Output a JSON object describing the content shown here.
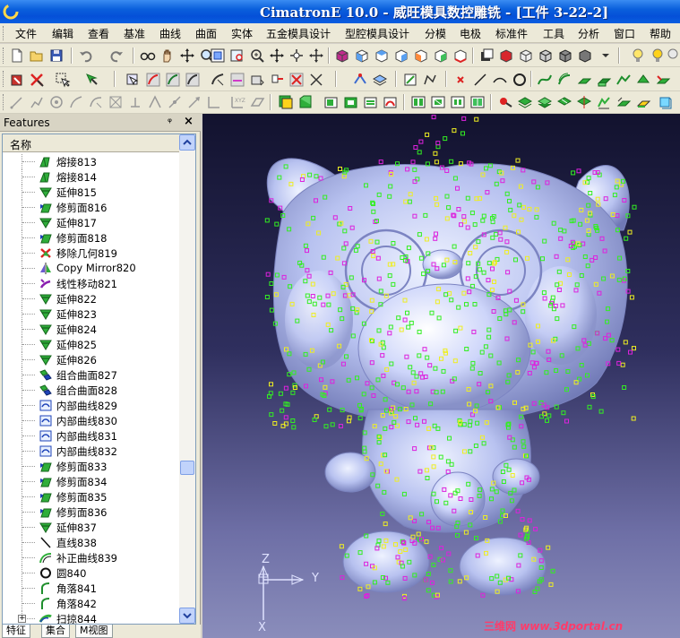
{
  "window": {
    "title": "CimatronE 10.0 - 威旺模具数控雕铣 - [工件 3-22-2]"
  },
  "menu": {
    "items": [
      "文件",
      "编辑",
      "查看",
      "基准",
      "曲线",
      "曲面",
      "实体",
      "五金模具设计",
      "型腔模具设计",
      "分模",
      "电极",
      "标准件",
      "工具",
      "分析",
      "窗口",
      "帮助"
    ]
  },
  "features_panel": {
    "title": "Features",
    "pin": "ᵠ",
    "close": "×",
    "column_header": "名称",
    "items": [
      {
        "label": "熔接813",
        "icon": "weld-icon"
      },
      {
        "label": "熔接814",
        "icon": "weld-icon"
      },
      {
        "label": "延伸815",
        "icon": "extend-icon"
      },
      {
        "label": "修剪面816",
        "icon": "trim-face-icon"
      },
      {
        "label": "延伸817",
        "icon": "extend-icon"
      },
      {
        "label": "修剪面818",
        "icon": "trim-face-icon"
      },
      {
        "label": "移除几何819",
        "icon": "remove-geometry-icon"
      },
      {
        "label": "Copy Mirror820",
        "icon": "mirror-icon"
      },
      {
        "label": "线性移动821",
        "icon": "linear-move-icon"
      },
      {
        "label": "延伸822",
        "icon": "extend-icon"
      },
      {
        "label": "延伸823",
        "icon": "extend-icon"
      },
      {
        "label": "延伸824",
        "icon": "extend-icon"
      },
      {
        "label": "延伸825",
        "icon": "extend-icon"
      },
      {
        "label": "延伸826",
        "icon": "extend-icon"
      },
      {
        "label": "组合曲面827",
        "icon": "combine-surface-icon"
      },
      {
        "label": "组合曲面828",
        "icon": "combine-surface-icon"
      },
      {
        "label": "内部曲线829",
        "icon": "internal-curve-icon"
      },
      {
        "label": "内部曲线830",
        "icon": "internal-curve-icon"
      },
      {
        "label": "内部曲线831",
        "icon": "internal-curve-icon"
      },
      {
        "label": "内部曲线832",
        "icon": "internal-curve-icon"
      },
      {
        "label": "修剪面833",
        "icon": "trim-face-icon"
      },
      {
        "label": "修剪面834",
        "icon": "trim-face-icon"
      },
      {
        "label": "修剪面835",
        "icon": "trim-face-icon"
      },
      {
        "label": "修剪面836",
        "icon": "trim-face-icon"
      },
      {
        "label": "延伸837",
        "icon": "extend-icon"
      },
      {
        "label": "直线838",
        "icon": "line-icon"
      },
      {
        "label": "补正曲线839",
        "icon": "offset-curve-icon"
      },
      {
        "label": "圆840",
        "icon": "circle-icon"
      },
      {
        "label": "角落841",
        "icon": "corner-icon"
      },
      {
        "label": "角落842",
        "icon": "corner-icon"
      },
      {
        "label": "扫掠844",
        "icon": "sweep-icon"
      }
    ],
    "tabs": [
      "特征",
      "集合",
      "M视图"
    ]
  },
  "viewport": {
    "axis_z": "Z",
    "axis_y": "Y",
    "axis_x": "X",
    "watermark_cn": "三维网",
    "watermark_en": "www.3dportal.cn",
    "colors": {
      "background_top": "#12122e",
      "background_bottom": "#8a8dbb",
      "model": "#b8c2f0",
      "point_green": "#33ee22",
      "point_magenta": "#dd22dd",
      "point_yellow": "#eeee22"
    }
  },
  "toolbar_icons": {
    "row1": [
      "new-file-icon",
      "open-file-icon",
      "save-icon",
      "undo-icon",
      "redo-icon",
      "glasses-icon",
      "pan-icon",
      "rotate-icon",
      "zoom-icon",
      "fit-view-icon",
      "view-cube-icon",
      "light-icon"
    ],
    "row2": [
      "select-icon",
      "delete-icon",
      "pick-icon",
      "filter-icon",
      "surface-select-icon",
      "edge-select-icon",
      "point-icon",
      "line-icon",
      "arc-icon",
      "circle-icon"
    ],
    "row3": [
      "pen-icon",
      "measure-icon",
      "coordinate-icon",
      "solid-box-icon",
      "solid-extrude-icon",
      "solid-shell-icon"
    ]
  }
}
